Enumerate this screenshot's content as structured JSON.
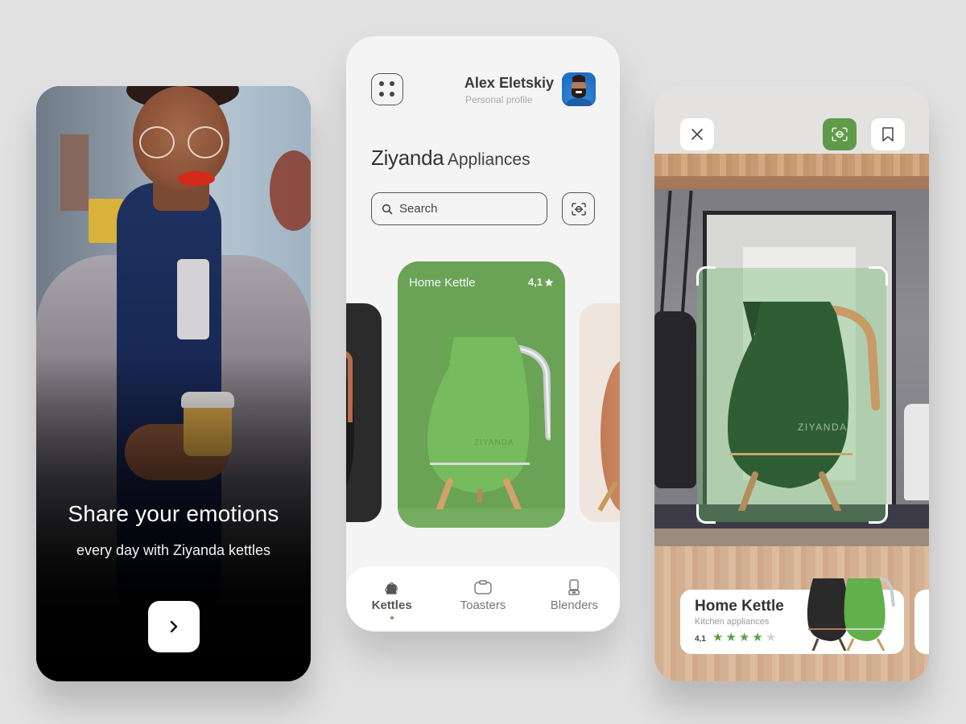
{
  "onboarding": {
    "title": "Share your emotions",
    "subtitle": "every day with Ziyanda kettles",
    "next_icon": "chevron-right-icon"
  },
  "catalog": {
    "menu_icon": "grid-dots-icon",
    "profile": {
      "name": "Alex Eletskiy",
      "subtitle": "Personal profile"
    },
    "brand": {
      "name": "Ziyanda",
      "suffix": "Appliances"
    },
    "search": {
      "placeholder": "Search",
      "icon": "search-icon",
      "scan_icon": "scan-icon"
    },
    "featured_card": {
      "title": "Home Kettle",
      "rating": "4,1",
      "rating_icon": "star-icon",
      "color": "#6aa356",
      "product_label": "ZIYANDA"
    },
    "nav": [
      {
        "label": "Kettles",
        "icon": "kettle-icon",
        "active": true
      },
      {
        "label": "Toasters",
        "icon": "toaster-icon",
        "active": false
      },
      {
        "label": "Blenders",
        "icon": "blender-icon",
        "active": false
      }
    ]
  },
  "ar_view": {
    "close_icon": "close-icon",
    "scan_icon": "scan-icon",
    "bookmark_icon": "bookmark-icon",
    "product_label": "ZIYANDA",
    "product_card": {
      "name": "Home Kettle",
      "category": "Kitchen appliances",
      "rating": "4,1",
      "stars_filled": 4,
      "stars_total": 5
    }
  },
  "colors": {
    "accent_green": "#6aa356",
    "scan_button_green": "#5f9a4b",
    "star_filled": "#5c9e4a",
    "star_empty": "#d0d0d0",
    "background": "#e1e1e1"
  }
}
